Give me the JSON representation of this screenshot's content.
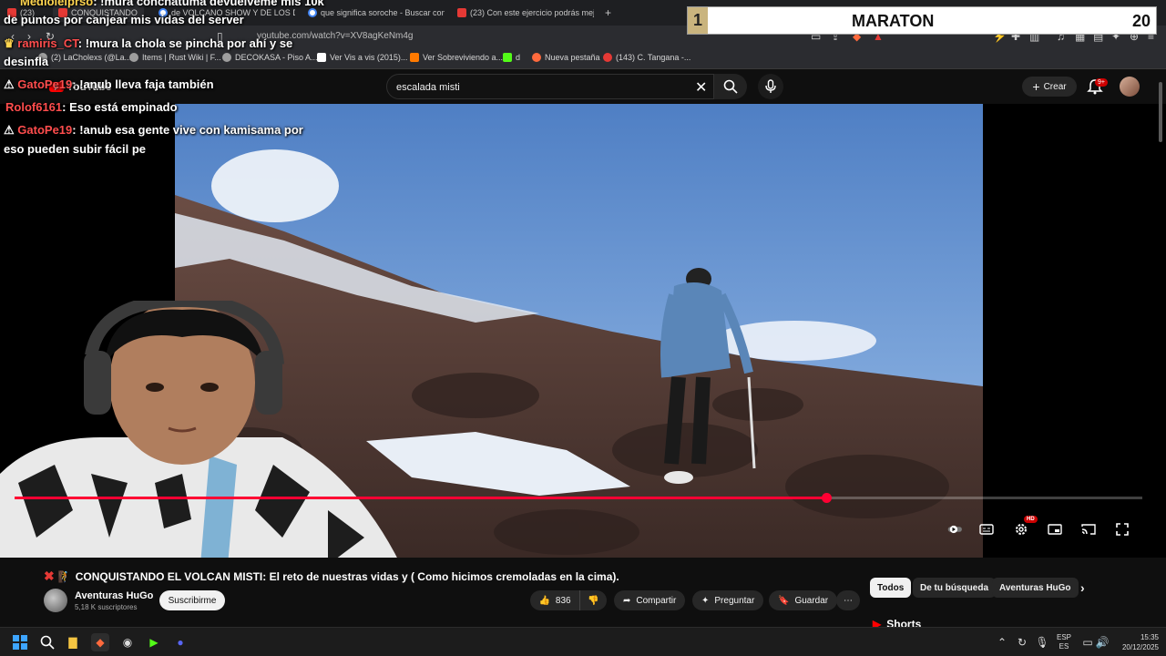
{
  "browser": {
    "tabs": [
      {
        "label": "(23)"
      },
      {
        "label": "CONQUISTANDO"
      },
      {
        "label": "de VOLCANO SHOW Y DE LOS DIBU..."
      },
      {
        "label": "que significa soroche - Buscar con G..."
      },
      {
        "label": "(23) Con este ejercicio podrás mejora..."
      }
    ],
    "url": "youtube.com/watch?v=XV8agKeNm4g",
    "bookmarks": [
      {
        "label": "(2) LaCholexs (@La..."
      },
      {
        "label": "Items | Rust Wiki | F..."
      },
      {
        "label": "DECOKASA - Piso A..."
      },
      {
        "label": "Ver Vis a vis (2015)..."
      },
      {
        "label": "Ver Sobreviviendo a..."
      },
      {
        "label": "d"
      },
      {
        "label": "Nueva pestaña"
      },
      {
        "label": "(143) C. Tangana -..."
      }
    ]
  },
  "youtube": {
    "logo_text": "YouTube",
    "search_value": "escalada misti",
    "create_label": "Crear",
    "notif_badge": "9+",
    "hd_badge": "HD"
  },
  "maraton": {
    "rank": "1",
    "title": "MARATON",
    "count": "20"
  },
  "chat": [
    {
      "user": "Mediolelprso",
      "message": ": !mura conchatuma devuelveme mis 10k"
    },
    {
      "user": "",
      "message": "de puntos por canjear mis vidas del server"
    },
    {
      "user": "ramiris_CT",
      "message": ": !mura la chola se pincha por ahí y se"
    },
    {
      "user": "",
      "message": "desinfla"
    },
    {
      "user": "GatoPe19",
      "message": ": !anub lleva faja también"
    },
    {
      "user": "Rolof6161",
      "message": ": Eso está empinado"
    },
    {
      "user": "GatoPe19",
      "message": ": !anub esa gente vive con kamisama por"
    },
    {
      "user": "",
      "message": "eso pueden subir fácil pe"
    }
  ],
  "video": {
    "progress": 0.72,
    "title": "CONQUISTANDO EL VOLCAN MISTI: El reto de nuestras vidas y ( Como hicimos cremoladas en la cima).",
    "channel": "Aventuras HuGo",
    "subscribers": "5,18 K suscriptores",
    "subscribe_label": "Suscribirme",
    "likes": "836",
    "share_label": "Compartir",
    "ask_label": "Preguntar",
    "save_label": "Guardar"
  },
  "chips": [
    {
      "label": "Todos"
    },
    {
      "label": "De tu búsqueda"
    },
    {
      "label": "Aventuras HuGo"
    }
  ],
  "shorts_label": "Shorts",
  "taskbar": {
    "lang_top": "ESP",
    "lang_bottom": "ES",
    "time": "15:35",
    "date": "20/12/2025"
  },
  "colors": {
    "accent": "#ff0033",
    "youtube_red": "#ff0000",
    "chat_user": "#ff4d4d"
  }
}
